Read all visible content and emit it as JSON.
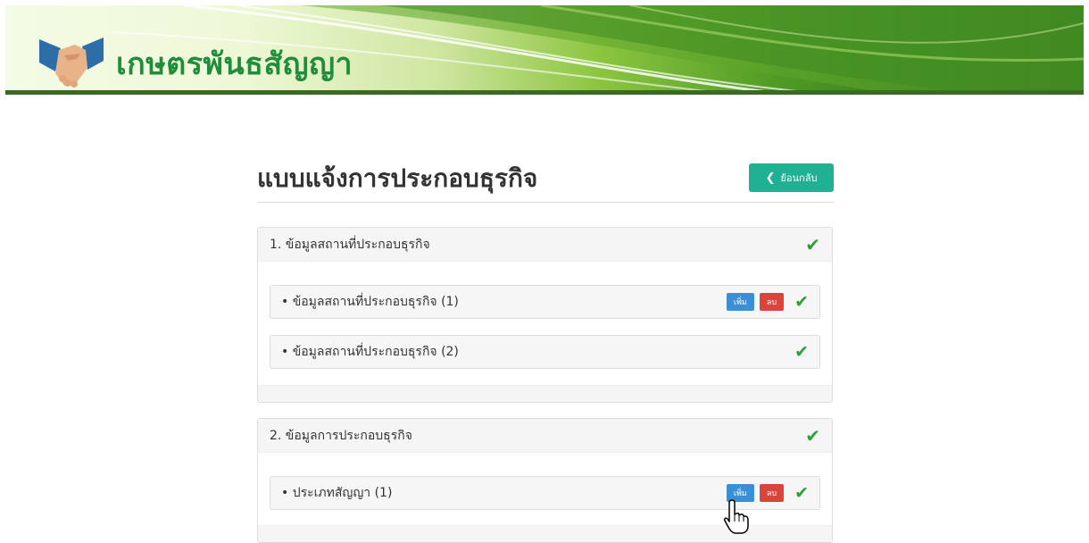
{
  "header": {
    "site_title": "เกษตรพันธสัญญา",
    "logo_icon": "handshake-icon",
    "colors": {
      "banner_dark": "#2e7a1c",
      "banner_light": "#eef8d6",
      "title": "#1f8d3a"
    }
  },
  "page": {
    "title": "แบบแจ้งการประกอบธุรกิจ",
    "back_label": "ย้อนกลับ",
    "back_icon": "chevron-left-icon",
    "accent": "#20b094"
  },
  "sections": [
    {
      "title": "1. ข้อมูลสถานที่ประกอบธุรกิจ",
      "status_icon": "check-icon",
      "items": [
        {
          "label": "• ข้อมูลสถานที่ประกอบธุรกิจ (1)",
          "add_label": "เพิ่ม",
          "delete_label": "ลบ",
          "status_icon": "check-icon"
        },
        {
          "label": "• ข้อมูลสถานที่ประกอบธุรกิจ (2)",
          "status_icon": "check-icon"
        }
      ]
    },
    {
      "title": "2. ข้อมูลการประกอบธุรกิจ",
      "status_icon": "check-icon",
      "items": [
        {
          "label": "• ประเภทสัญญา (1)",
          "add_label": "เพิ่ม",
          "delete_label": "ลบ",
          "status_icon": "check-icon"
        }
      ]
    }
  ],
  "colors": {
    "add": "#3a8fd6",
    "delete": "#d9443b",
    "check": "#2e9e3a"
  }
}
